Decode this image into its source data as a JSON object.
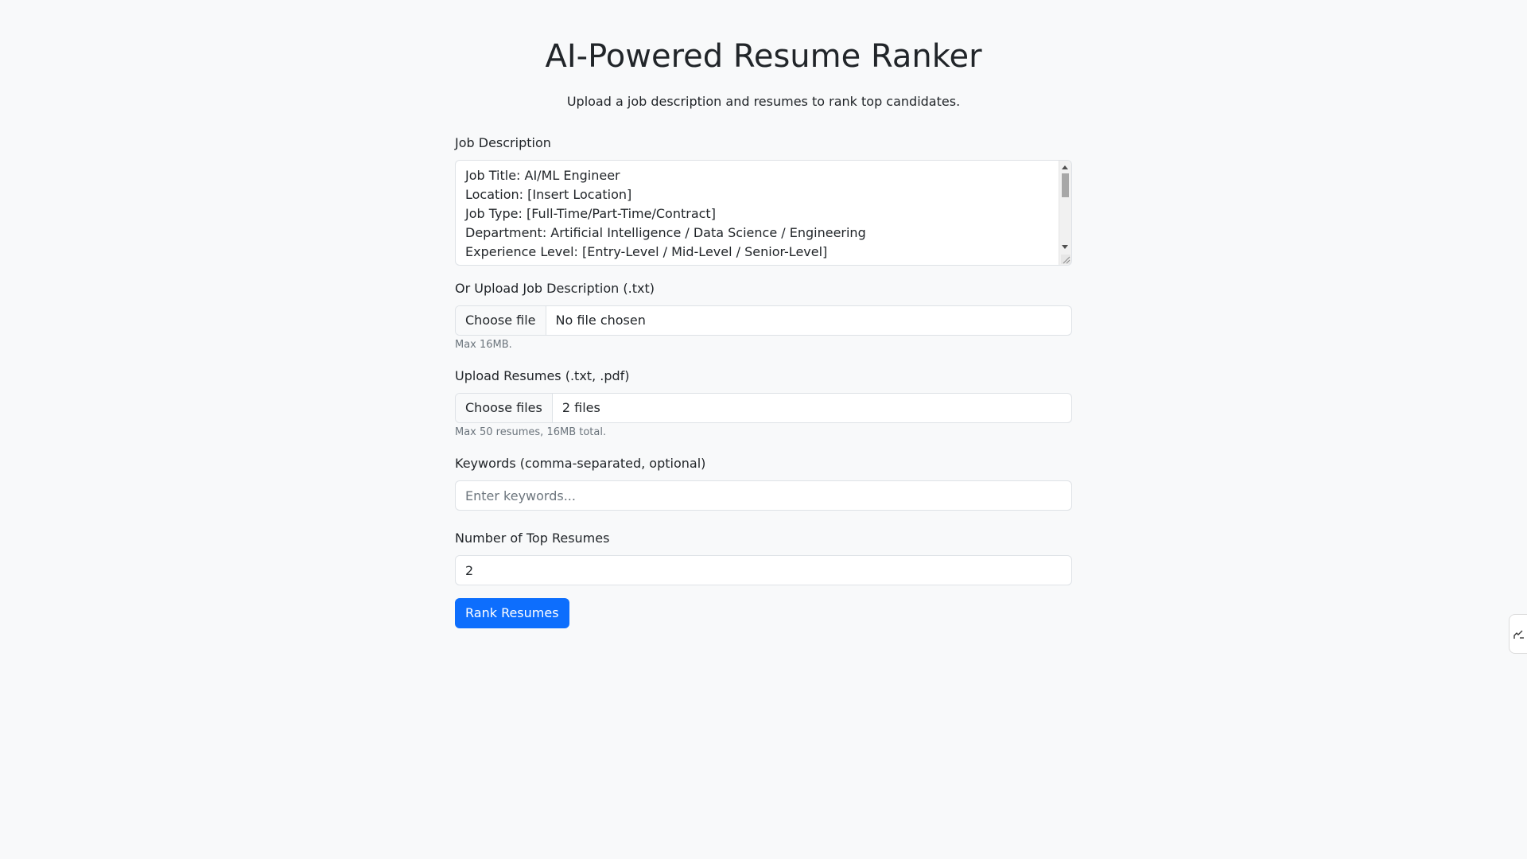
{
  "header": {
    "title": "AI-Powered Resume Ranker",
    "subtitle": "Upload a job description and resumes to rank top candidates."
  },
  "job_description": {
    "label": "Job Description",
    "lines": [
      "Job Title: AI/ML Engineer",
      "Location: [Insert Location]",
      "Job Type: [Full-Time/Part-Time/Contract]",
      "Department: Artificial Intelligence / Data Science / Engineering",
      "Experience Level: [Entry-Level / Mid-Level / Senior-Level]"
    ]
  },
  "upload_job_description": {
    "label": "Or Upload Job Description (.txt)",
    "button_label": "Choose file",
    "status": "No file chosen",
    "help": "Max 16MB."
  },
  "upload_resumes": {
    "label": "Upload Resumes (.txt, .pdf)",
    "button_label": "Choose files",
    "status": "2 files",
    "help": "Max 50 resumes, 16MB total."
  },
  "keywords": {
    "label": "Keywords (comma-separated, optional)",
    "value": "",
    "placeholder": "Enter keywords..."
  },
  "top_resumes": {
    "label": "Number of Top Resumes",
    "value": "2"
  },
  "submit": {
    "label": "Rank Resumes"
  },
  "colors": {
    "background": "#f8f9fa",
    "primary": "#0d6efd",
    "border": "#dee2e6",
    "muted_text": "#6c757d"
  },
  "icons": {
    "side_widget": "pen-icon"
  }
}
